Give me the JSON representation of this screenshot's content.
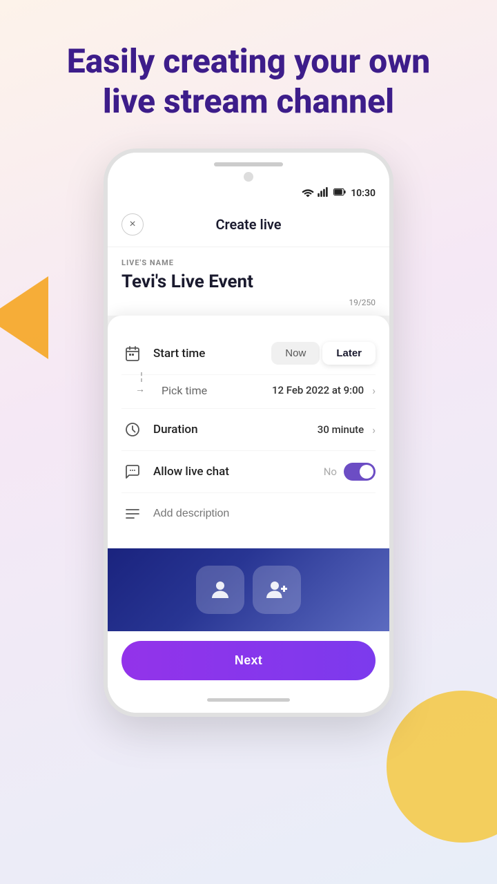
{
  "header": {
    "title_line1": "Easily creating your own",
    "title_line2": "live stream channel"
  },
  "phone": {
    "status_bar": {
      "time": "10:30"
    },
    "screen": {
      "nav": {
        "close_label": "×",
        "title": "Create live"
      },
      "live_name": {
        "label": "LIVE'S NAME",
        "value": "Tevi's Live Event",
        "char_count": "19/250"
      },
      "start_time": {
        "label": "Start time",
        "now_btn": "Now",
        "later_btn": "Later"
      },
      "pick_time": {
        "label": "Pick time",
        "value": "12 Feb 2022 at 9:00"
      },
      "duration": {
        "label": "Duration",
        "value": "30 minute"
      },
      "allow_chat": {
        "label": "Allow live chat",
        "status": "No"
      },
      "description": {
        "placeholder": "Add description"
      },
      "next_btn": "Next"
    }
  }
}
